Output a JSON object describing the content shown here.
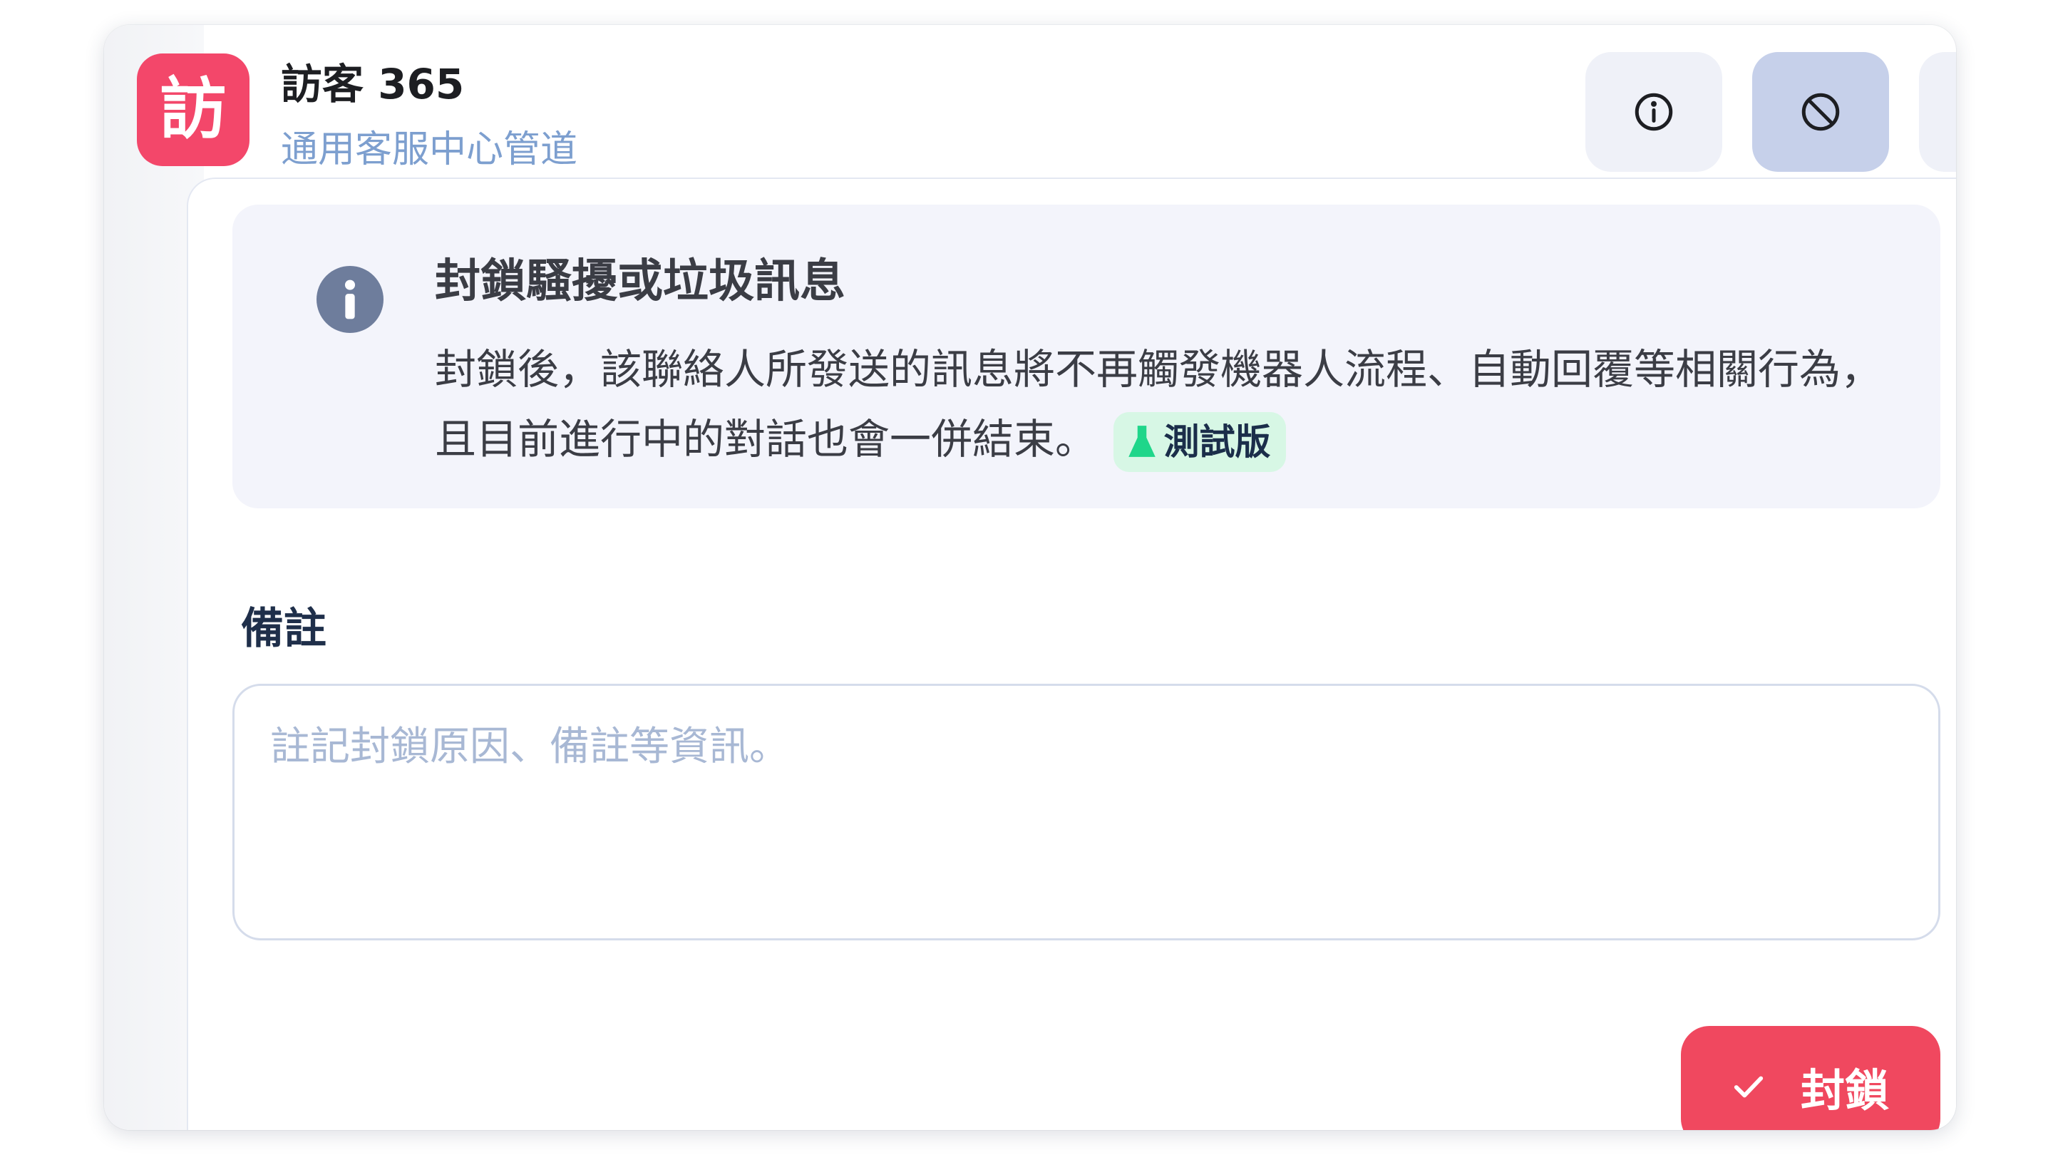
{
  "header": {
    "avatar_char": "訪",
    "title": "訪客 365",
    "subtitle": "通用客服中心管道",
    "buttons": [
      {
        "icon": "info-circle-icon",
        "active": false
      },
      {
        "icon": "block-icon",
        "active": true
      },
      {
        "icon": "message-dots-icon",
        "active": false
      }
    ]
  },
  "notice": {
    "icon": "info-filled-icon",
    "title": "封鎖騷擾或垃圾訊息",
    "body": "封鎖後，該聯絡人所發送的訊息將不再觸發機器人流程、自動回覆等相關行為，且目前進行中的對話也會一併結束。",
    "badge": {
      "icon": "flask-icon",
      "label": "測試版"
    }
  },
  "note": {
    "label": "備註",
    "value": "",
    "placeholder": "註記封鎖原因、備註等資訊。"
  },
  "action": {
    "icon": "check-icon",
    "label": "封鎖"
  },
  "colors": {
    "avatar": "#f3476a",
    "primary_action": "#f0485f",
    "active_tab": "#c6d0ea",
    "badge_bg": "#d7f7e5",
    "badge_icon": "#1fd68a"
  }
}
